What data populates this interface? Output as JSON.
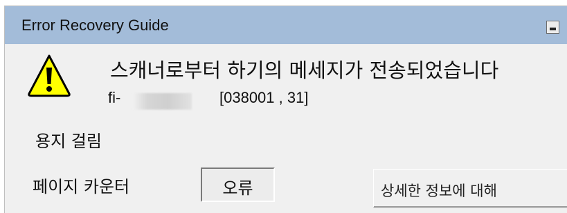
{
  "window": {
    "title": "Error Recovery Guide"
  },
  "message": {
    "main": "스캐너로부터 하기의 메세지가 전송되었습니다",
    "model_prefix": "fi-",
    "error_code": "[038001 , 31]",
    "status": "용지 걸림"
  },
  "counter": {
    "label": "페이지 카운터",
    "value": "오류"
  },
  "buttons": {
    "details_label": "상세한 정보에 대해"
  },
  "icons": {
    "warning": "warning-icon",
    "minimize": "minimize-icon"
  },
  "colors": {
    "titlebar": "#a3bcd9",
    "warning_fill": "#ffff00"
  }
}
